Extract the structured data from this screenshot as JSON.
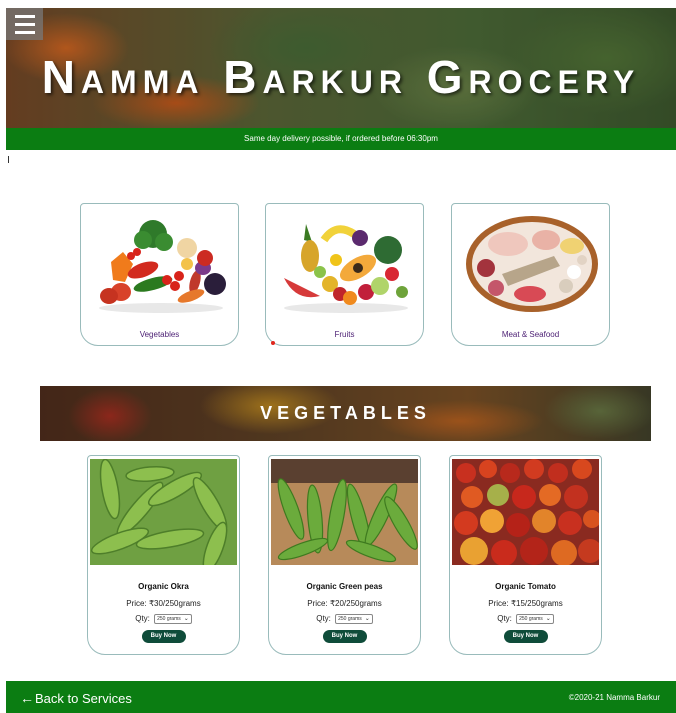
{
  "header": {
    "title": "Namma Barkur Grocery",
    "delivery_note": "Same day delivery possible, if ordered before 06:30pm"
  },
  "categories": [
    {
      "label": "Vegetables",
      "icon": "vegetables-image"
    },
    {
      "label": "Fruits",
      "icon": "fruits-image"
    },
    {
      "label": "Meat & Seafood",
      "icon": "meat-seafood-image"
    }
  ],
  "section": {
    "title": "VEGETABLES"
  },
  "products": [
    {
      "name": "Organic Okra",
      "price": "Price: ₹30/250grams",
      "qty_label": "Qty:",
      "qty_value": "250 grams",
      "buy_label": "Buy Now"
    },
    {
      "name": "Organic Green peas",
      "price": "Price: ₹20/250grams",
      "qty_label": "Qty:",
      "qty_value": "250 grams",
      "buy_label": "Buy Now"
    },
    {
      "name": "Organic Tomato",
      "price": "Price: ₹15/250grams",
      "qty_label": "Qty:",
      "qty_value": "250 grams",
      "buy_label": "Buy Now"
    }
  ],
  "footer": {
    "back_label": "Back to Services",
    "copyright": "2020-21 Namma Barkur"
  },
  "colors": {
    "brand_green": "#0b7d12",
    "button_green": "#0f4c3a",
    "category_label": "#4b1e73"
  }
}
